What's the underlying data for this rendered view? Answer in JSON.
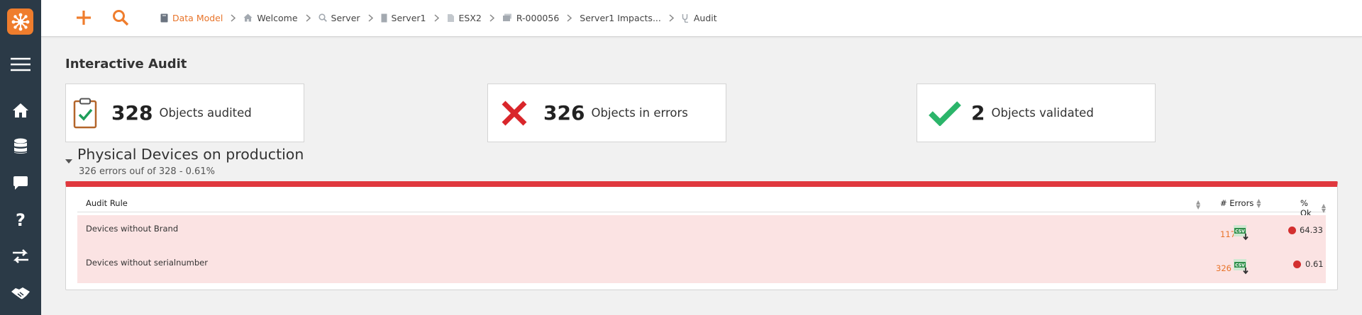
{
  "colors": {
    "accent": "#e8742a",
    "sidebar": "#2b3a47",
    "error_bar": "#e0383e",
    "row_bg": "#fbe3e3",
    "ok_green": "#2bb56a",
    "error_red": "#d9262b"
  },
  "sidebar": {
    "logo_icon": "hub-logo-icon",
    "items": [
      {
        "icon": "hamburger-menu-icon"
      },
      {
        "icon": "home-icon"
      },
      {
        "icon": "database-icon"
      },
      {
        "icon": "chat-bubble-icon"
      },
      {
        "icon": "question-mark-icon"
      },
      {
        "icon": "swap-arrows-icon"
      },
      {
        "icon": "handshake-icon"
      }
    ]
  },
  "topbar": {
    "add_icon": "plus-icon",
    "search_icon": "search-icon",
    "breadcrumbs": [
      {
        "label": "Data Model",
        "icon": "book-icon"
      },
      {
        "label": "Welcome",
        "icon": "home-icon"
      },
      {
        "label": "Server",
        "icon": "search-icon"
      },
      {
        "label": "Server1",
        "icon": "server-icon"
      },
      {
        "label": "ESX2",
        "icon": "document-icon"
      },
      {
        "label": "R-000056",
        "icon": "stack-icon"
      },
      {
        "label": "Server1 Impacts..."
      },
      {
        "label": "Audit",
        "icon": "stethoscope-icon"
      }
    ]
  },
  "page": {
    "title": "Interactive Audit"
  },
  "summary": [
    {
      "value": "328",
      "label": "Objects audited",
      "icon": "clipboard-check-icon"
    },
    {
      "value": "326",
      "label": "Objects in errors",
      "icon": "red-cross-icon"
    },
    {
      "value": "2",
      "label": "Objects validated",
      "icon": "green-check-icon"
    }
  ],
  "section": {
    "title": "Physical Devices on production",
    "subtitle": "326 errors ouf of 328 - 0.61%",
    "columns": {
      "rule": "Audit Rule",
      "errors": "# Errors",
      "ok": "% Ok"
    },
    "rows": [
      {
        "rule": "Devices without Brand",
        "errors": "117",
        "ok": "64.33"
      },
      {
        "rule": "Devices without serialnumber",
        "errors": "326",
        "ok": "0.61"
      }
    ]
  }
}
